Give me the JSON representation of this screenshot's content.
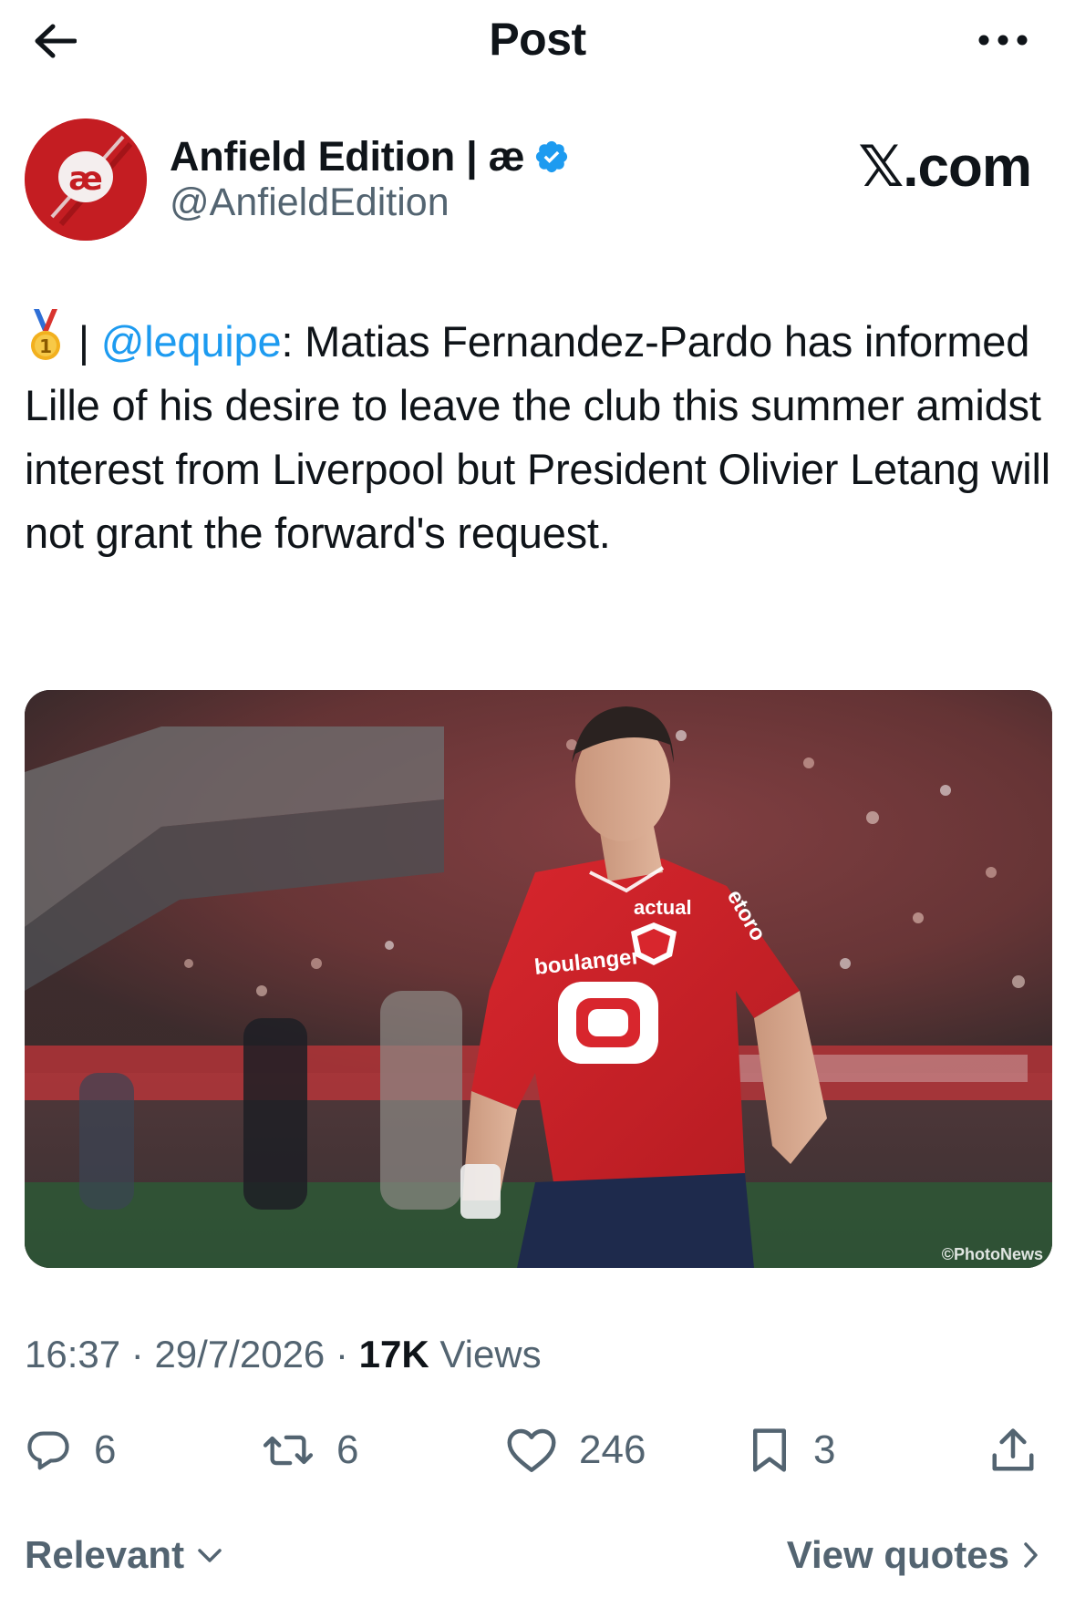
{
  "header": {
    "title": "Post",
    "back_icon": "arrow-left-icon",
    "more_icon": "more-horizontal-icon"
  },
  "author": {
    "avatar_text": "æ",
    "name": "Anfield Edition | æ",
    "handle": "@AnfieldEdition",
    "verified": true,
    "avatar_color": "#c41d22"
  },
  "watermark": {
    "x_mark": "𝕏",
    "suffix": ".com"
  },
  "post": {
    "medal_icon": "gold-medal-icon",
    "separator": " | ",
    "mention": "@lequipe",
    "body": ": Matias Fernandez-Pardo has informed Lille of his desire to leave the club this summer amidst interest from Liverpool but President Olivier Letang will not grant the forward's request."
  },
  "media": {
    "credit": "©PhotoNews",
    "shirt_text_top": "actual",
    "shirt_text_sponsor": "boulanger",
    "shirt_text_sleeve": "etoro"
  },
  "meta": {
    "time": "16:37",
    "dot1": " · ",
    "date": "29/7/2026",
    "dot2": " · ",
    "views_count": "17K",
    "views_label": " Views"
  },
  "actions": {
    "replies": "6",
    "reposts": "6",
    "likes": "246",
    "bookmarks": "3"
  },
  "footer": {
    "sort_label": "Relevant",
    "quotes_label": "View quotes"
  },
  "colors": {
    "accent": "#1d9bf0",
    "secondary_text": "#536471",
    "primary_text": "#0f1419"
  }
}
